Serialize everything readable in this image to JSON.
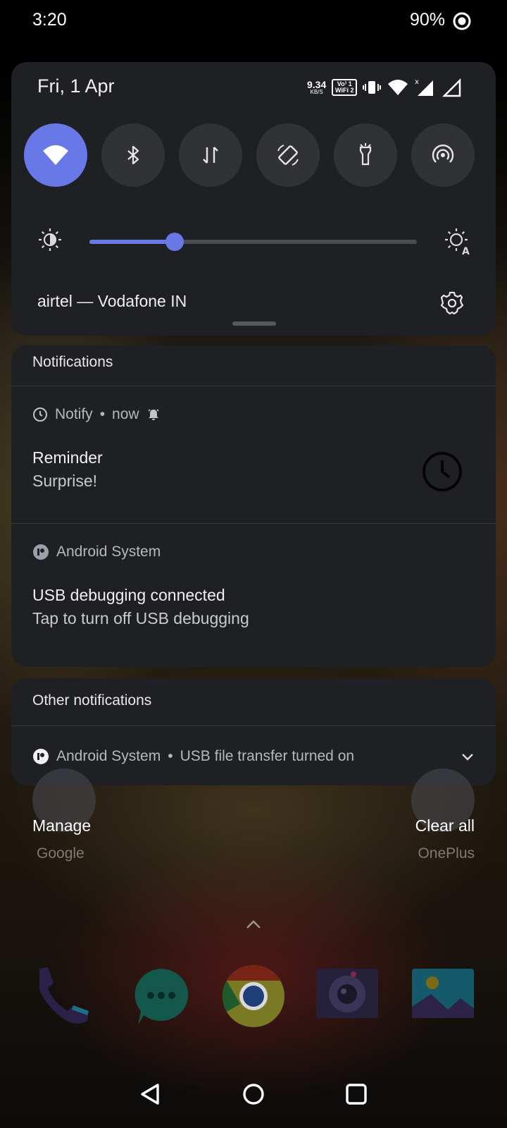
{
  "status_bar": {
    "time": "3:20",
    "battery": "90%"
  },
  "quick_settings": {
    "date": "Fri, 1 Apr",
    "net_speed_value": "9.34",
    "net_speed_unit": "KB/S",
    "volte_line1": "Vo⁾ 1",
    "volte_line2": "WiFi 2",
    "tiles": [
      {
        "name": "wifi-icon",
        "active": true
      },
      {
        "name": "bluetooth-icon",
        "active": false
      },
      {
        "name": "mobile-data-icon",
        "active": false
      },
      {
        "name": "auto-rotate-icon",
        "active": false
      },
      {
        "name": "flashlight-icon",
        "active": false
      },
      {
        "name": "hotspot-icon",
        "active": false
      }
    ],
    "brightness_level": 0.26,
    "carrier": "airtel — Vodafone IN",
    "accent_color": "#6878e6"
  },
  "notifications": {
    "header": "Notifications",
    "items": [
      {
        "app": "Notify",
        "time": "now",
        "title": "Reminder",
        "text": "Surprise!"
      },
      {
        "app": "Android System",
        "title": "USB debugging connected",
        "text": "Tap to turn off USB debugging"
      }
    ]
  },
  "other_notifications": {
    "header": "Other notifications",
    "app": "Android System",
    "text": "USB file transfer turned on"
  },
  "home": {
    "manage": "Manage",
    "clear_all": "Clear all",
    "folder_left": "Google",
    "folder_right": "OnePlus"
  }
}
